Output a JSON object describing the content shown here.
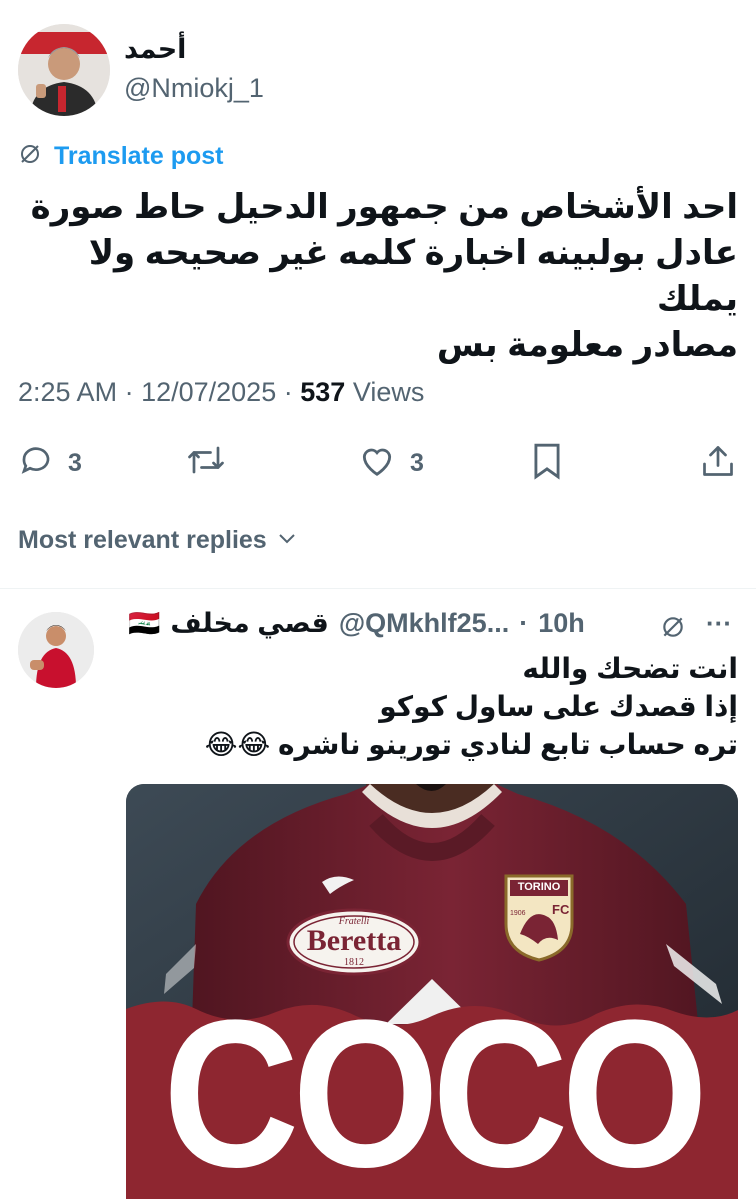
{
  "post": {
    "author_name": "أحمد",
    "author_handle": "@Nmiokj_1",
    "translate_label": "Translate post",
    "text_lines": [
      "احد الأشخاص من جمهور الدحيل حاط صورة",
      "عادل بولبينه اخبارة كلمه غير صحيحه ولا يملك",
      "مصادر معلومة بس"
    ],
    "time": "2:25 AM",
    "date": "12/07/2025",
    "views_count": "537",
    "views_label": "Views",
    "replies_count": "3",
    "likes_count": "3"
  },
  "replies_filter": "Most relevant replies",
  "reply": {
    "author_name": "قصي مخلف",
    "flag": "🇮🇶",
    "handle": "@QMkhlf25...",
    "time": "10h",
    "more": "···",
    "text_lines": [
      "انت تضحك والله",
      "إذا قصدك على ساول كوكو",
      "تره حساب تابع لنادي تورينو ناشره 😂😂"
    ],
    "image": {
      "sponsor_top": "Fratelli",
      "sponsor": "Beretta",
      "sponsor_year": "1812",
      "badge_text": "TORINO",
      "badge_year": "1906",
      "badge_fc": "FC",
      "banner_text": "COCO"
    }
  },
  "colors": {
    "accent": "#1d9bf0",
    "muted": "#536471",
    "jersey": "#6b1f2e",
    "banner": "#8e2630"
  }
}
